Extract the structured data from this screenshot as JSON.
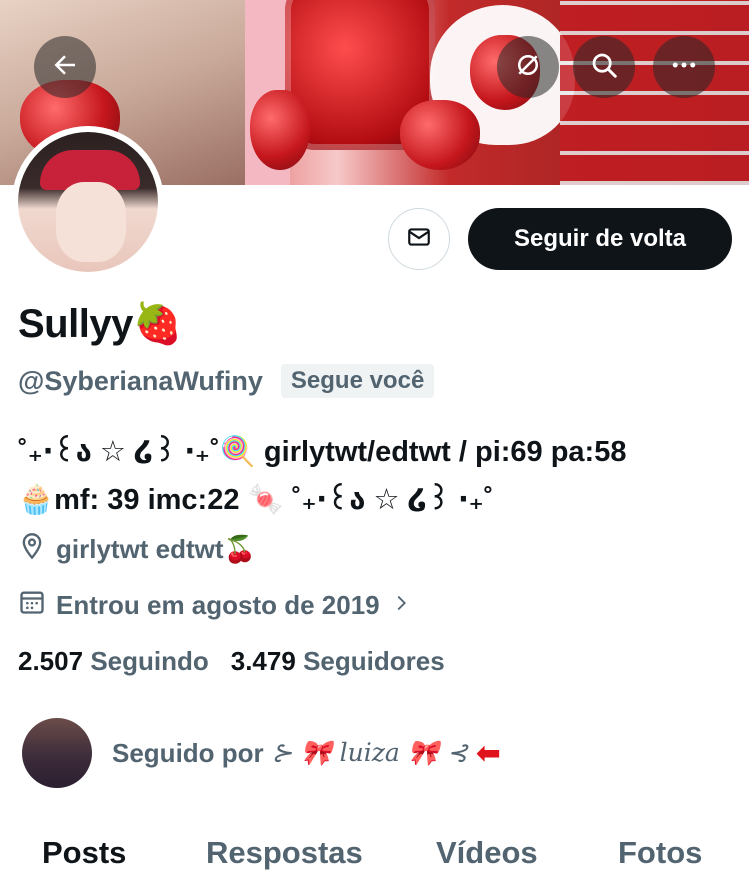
{
  "header": {
    "back_icon": "arrow-left-icon",
    "grok_icon": "grok-icon",
    "search_icon": "search-icon",
    "more_icon": "more-icon"
  },
  "actions": {
    "message_icon": "envelope-icon",
    "follow_label": "Seguir de volta"
  },
  "profile": {
    "name": "Sullyy🍓",
    "handle": "@SyberianaWufiny",
    "follows_you_badge": "Segue você",
    "bio_line1": "˚₊‧꒰ა ☆ ໒꒱ ‧₊˚🍭 girlytwt/edtwt / pi:69 pa:58",
    "bio_line2": "🧁mf: 39 imc:22 🍬 ˚₊‧꒰ა ☆ ໒꒱ ‧₊˚",
    "location": "girlytwt edtwt🍒",
    "joined": "Entrou em agosto de 2019"
  },
  "stats": {
    "following_count": "2.507",
    "following_label": "Seguindo",
    "followers_count": "3.479",
    "followers_label": "Seguidores"
  },
  "followed_by": {
    "label": "Seguido por",
    "name": "⊱ 🎀 luiza 🎀 ⊰"
  },
  "tabs": [
    {
      "label": "Posts",
      "active": true
    },
    {
      "label": "Respostas",
      "active": false
    },
    {
      "label": "Vídeos",
      "active": false
    },
    {
      "label": "Fotos",
      "active": false
    }
  ],
  "colors": {
    "primary_text": "#0f1419",
    "secondary_text": "#536471",
    "button_dark": "#0f1419",
    "annotation_arrow": "#e0121b"
  }
}
